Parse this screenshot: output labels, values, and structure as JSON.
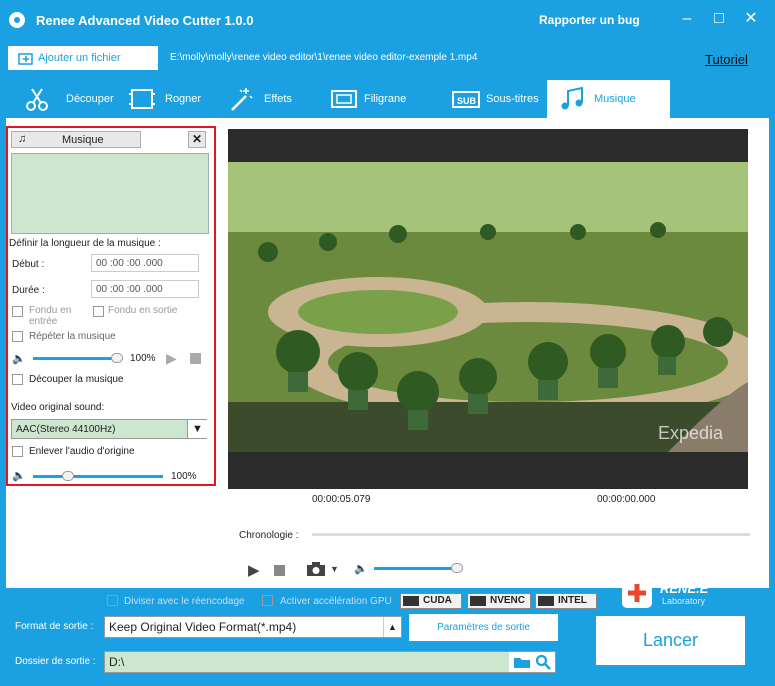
{
  "app": {
    "title": "Renee Advanced Video Cutter 1.0.0",
    "report_bug": "Rapporter un bug"
  },
  "toolbar": {
    "add_file": "Ajouter un fichier",
    "file_path": "E:\\molly\\molly\\renee video editor\\1\\renee video editor-exemple 1.mp4",
    "tutorial": "Tutoriel"
  },
  "tabs": [
    {
      "label": "Découper"
    },
    {
      "label": "Rogner"
    },
    {
      "label": "Effets"
    },
    {
      "label": "Filigrane"
    },
    {
      "label": "Sous-titres"
    },
    {
      "label": "Musique"
    }
  ],
  "music": {
    "button": "Musique",
    "length_heading": "Définir la longueur de la musique :",
    "start_label": "Début :",
    "start_value": "00 :00 :00 .000",
    "duration_label": "Durée :",
    "duration_value": "00 :00 :00 .000",
    "fade_in": "Fondu en entrée",
    "fade_out": "Fondu en sortie",
    "repeat": "Répéter la musique",
    "volume": "100%",
    "cut_music": "Découper la musique",
    "original_sound_label": "Video original sound:",
    "original_sound_value": "AAC(Stereo 44100Hz)",
    "remove_audio": "Enlever l'audio d'origine",
    "volume2": "100%"
  },
  "player": {
    "time_current": "00:00:05.079",
    "time_end": "00:00:00.000",
    "timeline_label": "Chronologie :",
    "watermark": "Expedia"
  },
  "bottom": {
    "split_reencode": "Diviser avec le réencodage",
    "gpu_accel": "Activer accélération GPU",
    "gpu": [
      "CUDA",
      "NVENC",
      "INTEL"
    ],
    "format_label": "Format de sortie :",
    "format_value": "Keep Original Video Format(*.mp4)",
    "params_button": "Paramètres de sortie",
    "folder_label": "Dossier de sortie :",
    "folder_value": "D:\\",
    "launch": "Lancer",
    "logo_line1": "RENE.E",
    "logo_line2": "Laboratory"
  }
}
